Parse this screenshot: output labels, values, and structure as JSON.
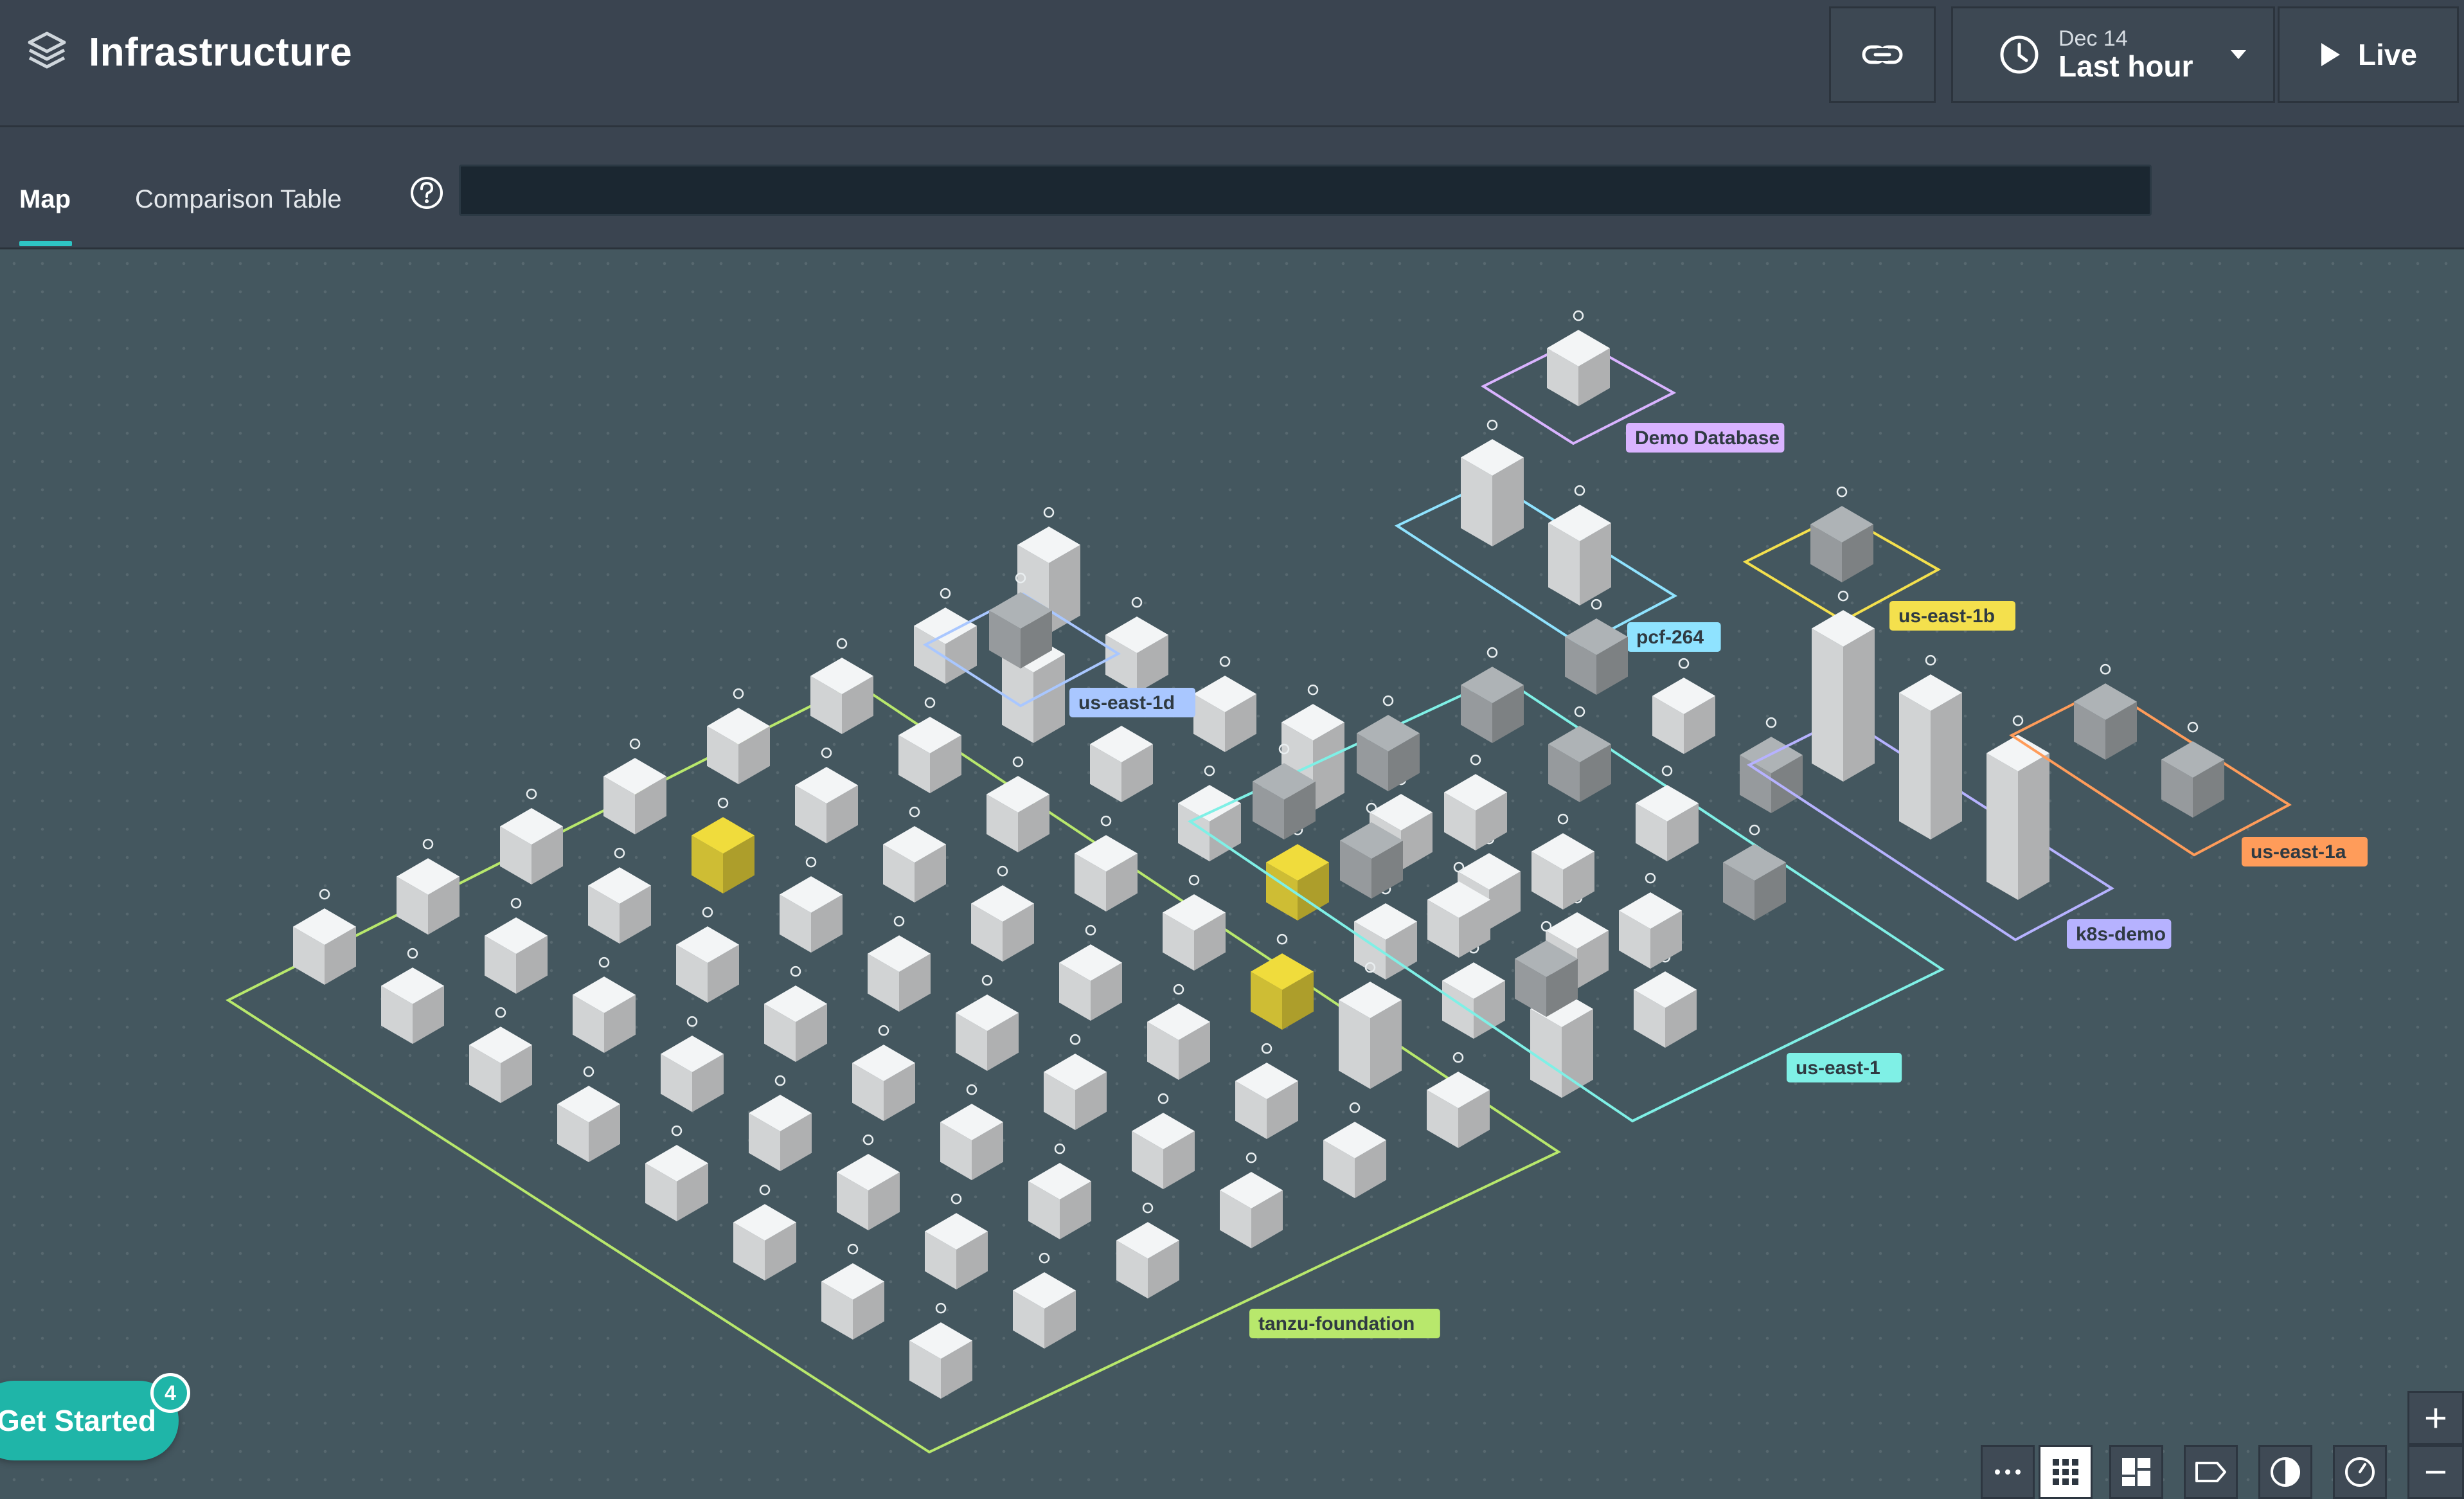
{
  "header": {
    "title": "Infrastructure",
    "time": {
      "date": "Dec 14",
      "range": "Last hour"
    },
    "live_label": "Live"
  },
  "tabs": [
    {
      "label": "Map",
      "active": true
    },
    {
      "label": "Comparison Table",
      "active": false
    }
  ],
  "filter": {
    "value": ""
  },
  "get_started": {
    "label": "Get Started",
    "badge": "4"
  },
  "groups": [
    {
      "label": "tanzu-foundation",
      "color": "#b8e86c",
      "hosts": 64
    },
    {
      "label": "us-east-1d",
      "color": "#a9c7ff",
      "hosts": 1
    },
    {
      "label": "Demo Database",
      "color": "#d9b3ff",
      "hosts": 1
    },
    {
      "label": "pcf-264",
      "color": "#8fe3ff",
      "hosts": 2
    },
    {
      "label": "us-east-1b",
      "color": "#f4e04d",
      "hosts": 1
    },
    {
      "label": "us-east-1",
      "color": "#7ff0e6",
      "hosts": 15
    },
    {
      "label": "k8s-demo",
      "color": "#b6b2ff",
      "hosts": 3
    },
    {
      "label": "us-east-1a",
      "color": "#ff9c5a",
      "hosts": 2
    }
  ],
  "colors": {
    "host_ok": "#f3f5f6",
    "host_warning": "#f0dc3c",
    "host_inactive": "#aeb3b6",
    "accent": "#2ec4c4"
  }
}
